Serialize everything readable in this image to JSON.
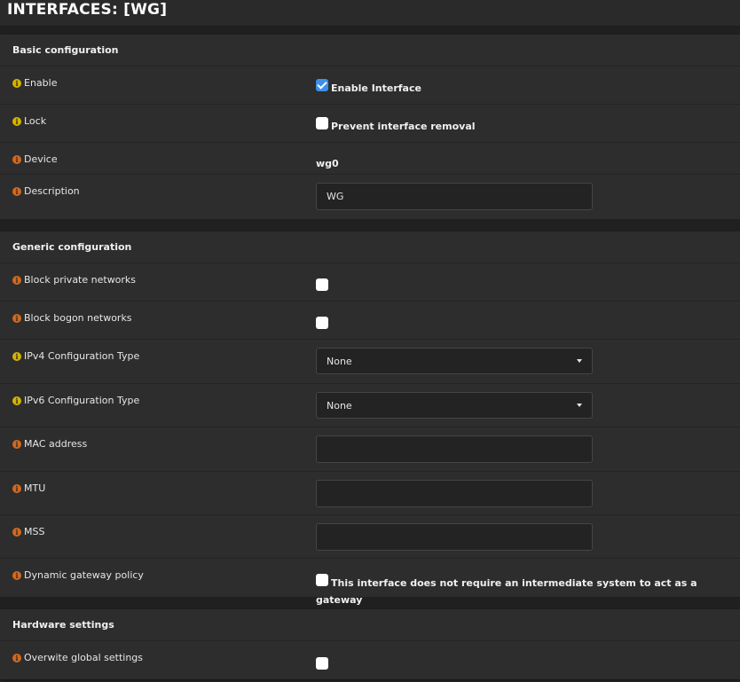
{
  "header": {
    "title": "INTERFACES: [WG]"
  },
  "sections": {
    "basic": {
      "title": "Basic configuration",
      "enable": {
        "label": "Enable",
        "checkbox_label": "Enable Interface",
        "checked": true
      },
      "lock": {
        "label": "Lock",
        "checkbox_label": "Prevent interface removal",
        "checked": false
      },
      "device": {
        "label": "Device",
        "value": "wg0"
      },
      "description": {
        "label": "Description",
        "value": "WG"
      }
    },
    "generic": {
      "title": "Generic configuration",
      "block_private": {
        "label": "Block private networks",
        "checked": false
      },
      "block_bogon": {
        "label": "Block bogon networks",
        "checked": false
      },
      "ipv4_type": {
        "label": "IPv4 Configuration Type",
        "selected": "None"
      },
      "ipv6_type": {
        "label": "IPv6 Configuration Type",
        "selected": "None"
      },
      "mac": {
        "label": "MAC address",
        "value": ""
      },
      "mtu": {
        "label": "MTU",
        "value": ""
      },
      "mss": {
        "label": "MSS",
        "value": ""
      },
      "dyn_gw": {
        "label": "Dynamic gateway policy",
        "checkbox_label": "This interface does not require an intermediate system to act as a gateway",
        "checked": false
      }
    },
    "hardware": {
      "title": "Hardware settings",
      "overwrite": {
        "label": "Overwite global settings",
        "checked": false
      }
    }
  },
  "icons": {
    "info_yellow": "info-circle-icon",
    "info_orange": "info-circle-icon"
  },
  "colors": {
    "info_yellow": "#d4b400",
    "info_orange": "#d2691e",
    "checkbox_checked": "#3b8fe8"
  }
}
